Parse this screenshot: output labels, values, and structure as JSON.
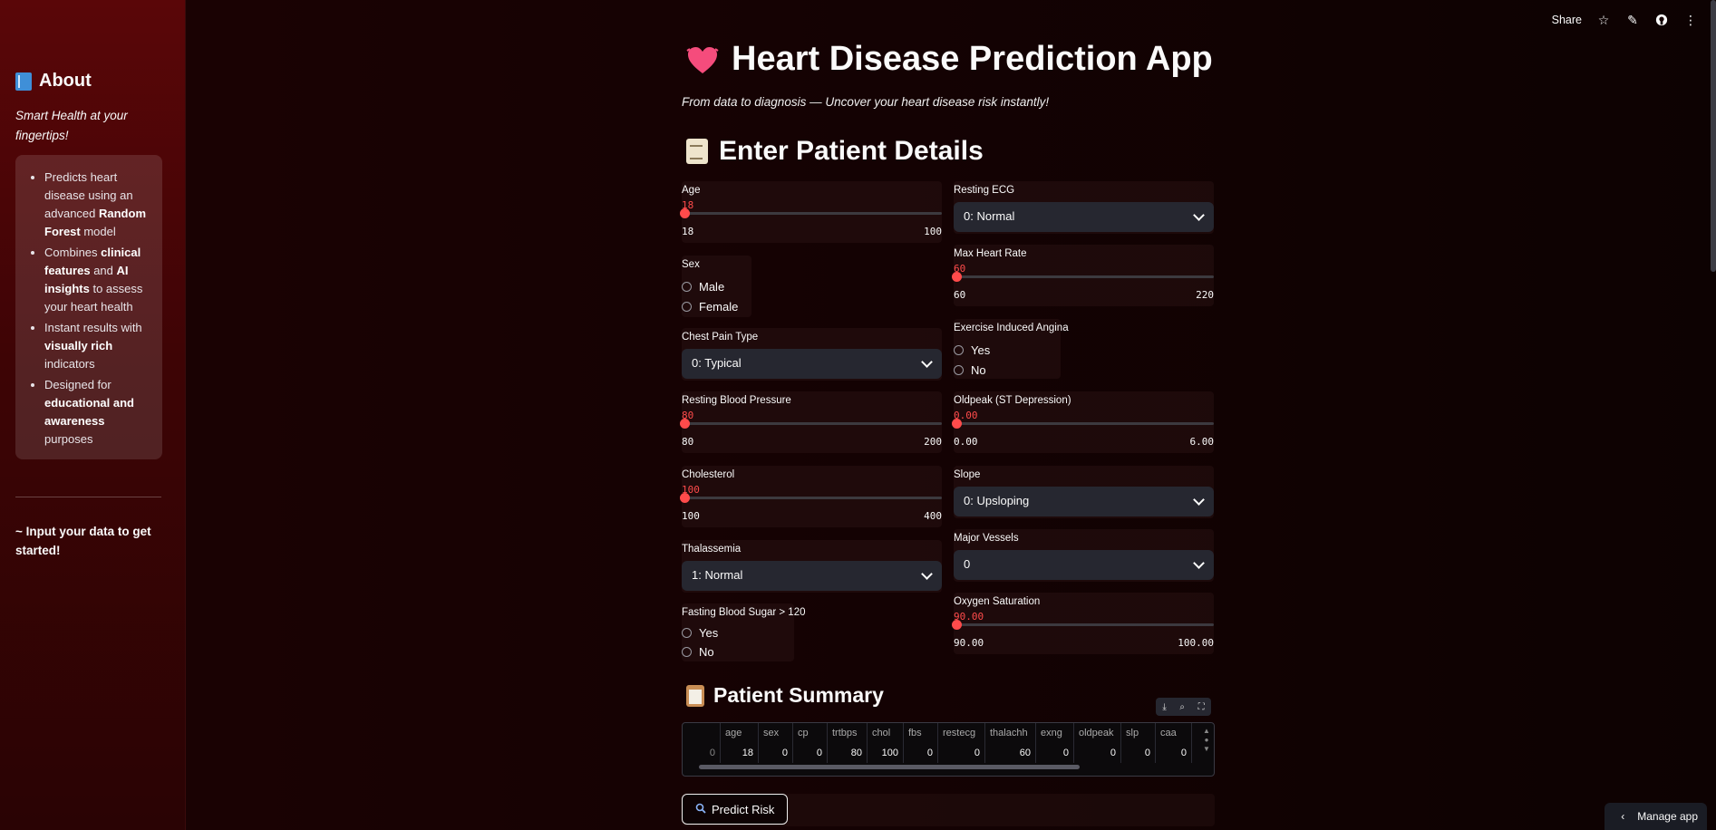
{
  "sidebar": {
    "title": "About",
    "tagline": "Smart Health at your fingertips!",
    "bullets": [
      {
        "pre": "Predicts heart disease using an advanced ",
        "bold": "Random Forest",
        "post": " model"
      },
      {
        "pre": "Combines ",
        "bold": "clinical features",
        "mid": " and ",
        "bold2": "AI insights",
        "post": " to assess your heart health"
      },
      {
        "pre": "Instant results with ",
        "bold": "visually rich",
        "post": " indicators"
      },
      {
        "pre": "Designed for ",
        "bold": "educational and awareness",
        "post": " purposes"
      }
    ],
    "cta": "~ Input your data to get started!"
  },
  "toolbar": {
    "share_label": "Share"
  },
  "header": {
    "title": "Heart Disease Prediction App",
    "subtitle": "From data to diagnosis — Uncover your heart disease risk instantly!"
  },
  "section_title": "Enter Patient Details",
  "fields": {
    "age": {
      "label": "Age",
      "value": "18",
      "min": "18",
      "max": "100",
      "level": 0
    },
    "sex": {
      "label": "Sex",
      "options": [
        "Male",
        "Female"
      ]
    },
    "chest_pain": {
      "label": "Chest Pain Type",
      "value": "0: Typical"
    },
    "rest_bp": {
      "label": "Resting Blood Pressure",
      "value": "80",
      "min": "80",
      "max": "200",
      "level": 0
    },
    "cholesterol": {
      "label": "Cholesterol",
      "value": "100",
      "min": "100",
      "max": "400",
      "level": 0
    },
    "thalassemia": {
      "label": "Thalassemia",
      "value": "1: Normal"
    },
    "fbs": {
      "label": "Fasting Blood Sugar > 120",
      "options": [
        "Yes",
        "No"
      ]
    },
    "rest_ecg": {
      "label": "Resting ECG",
      "value": "0: Normal"
    },
    "max_hr": {
      "label": "Max Heart Rate",
      "value": "60",
      "min": "60",
      "max": "220",
      "level": 0
    },
    "angina": {
      "label": "Exercise Induced Angina",
      "options": [
        "Yes",
        "No"
      ]
    },
    "oldpeak": {
      "label": "Oldpeak (ST Depression)",
      "value": "0.00",
      "min": "0.00",
      "max": "6.00",
      "level": 0
    },
    "slope": {
      "label": "Slope",
      "value": "0: Upsloping"
    },
    "vessels": {
      "label": "Major Vessels",
      "value": "0"
    },
    "oxygen": {
      "label": "Oxygen Saturation",
      "value": "90.00",
      "min": "90.00",
      "max": "100.00",
      "level": 0
    }
  },
  "summary": {
    "title": "Patient Summary",
    "columns": [
      "",
      "age",
      "sex",
      "cp",
      "trtbps",
      "chol",
      "fbs",
      "restecg",
      "thalachh",
      "exng",
      "oldpeak",
      "slp",
      "caa"
    ],
    "row": [
      "0",
      "18",
      "0",
      "0",
      "80",
      "100",
      "0",
      "0",
      "60",
      "0",
      "0",
      "0",
      "0"
    ]
  },
  "predict_button": "Predict Risk",
  "manage_app": "Manage app",
  "colors": {
    "accent": "#ff4b4b",
    "sidebar": "#5a0608",
    "background": "#150203"
  }
}
